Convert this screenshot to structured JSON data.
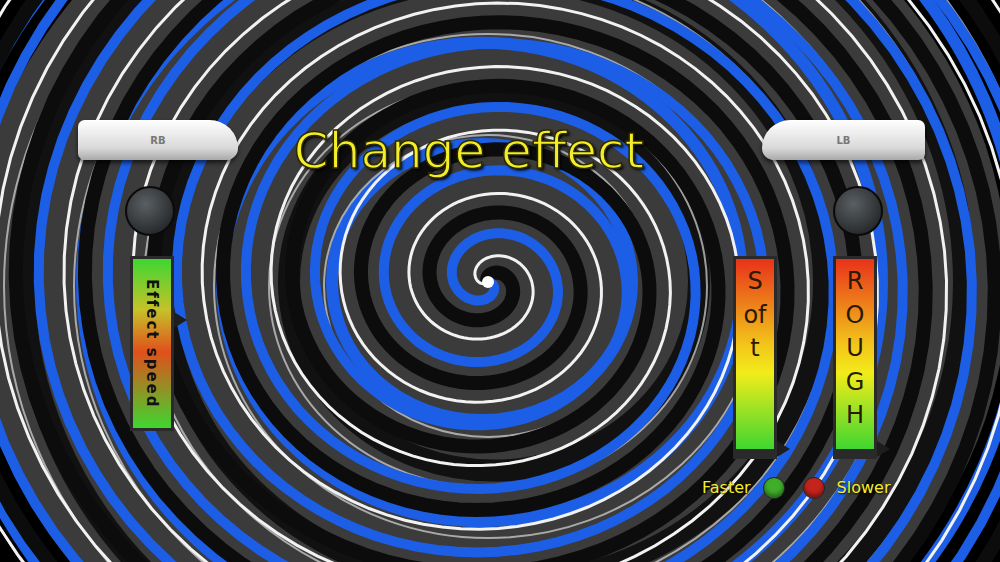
{
  "title": "Change effect",
  "shoulder_buttons": [
    {
      "label": "RB"
    },
    {
      "label": "LB"
    }
  ],
  "effect_speed": {
    "label": "Effect speed",
    "level": 0.64
  },
  "intensity_bars": [
    {
      "label": "Soft",
      "level": 0.0
    },
    {
      "label": "ROUGH",
      "level": 0.0
    }
  ],
  "speed_controls": [
    {
      "label": "Faster",
      "color": "#3fae2a"
    },
    {
      "label": "Slower",
      "color": "#c4241c"
    }
  ]
}
